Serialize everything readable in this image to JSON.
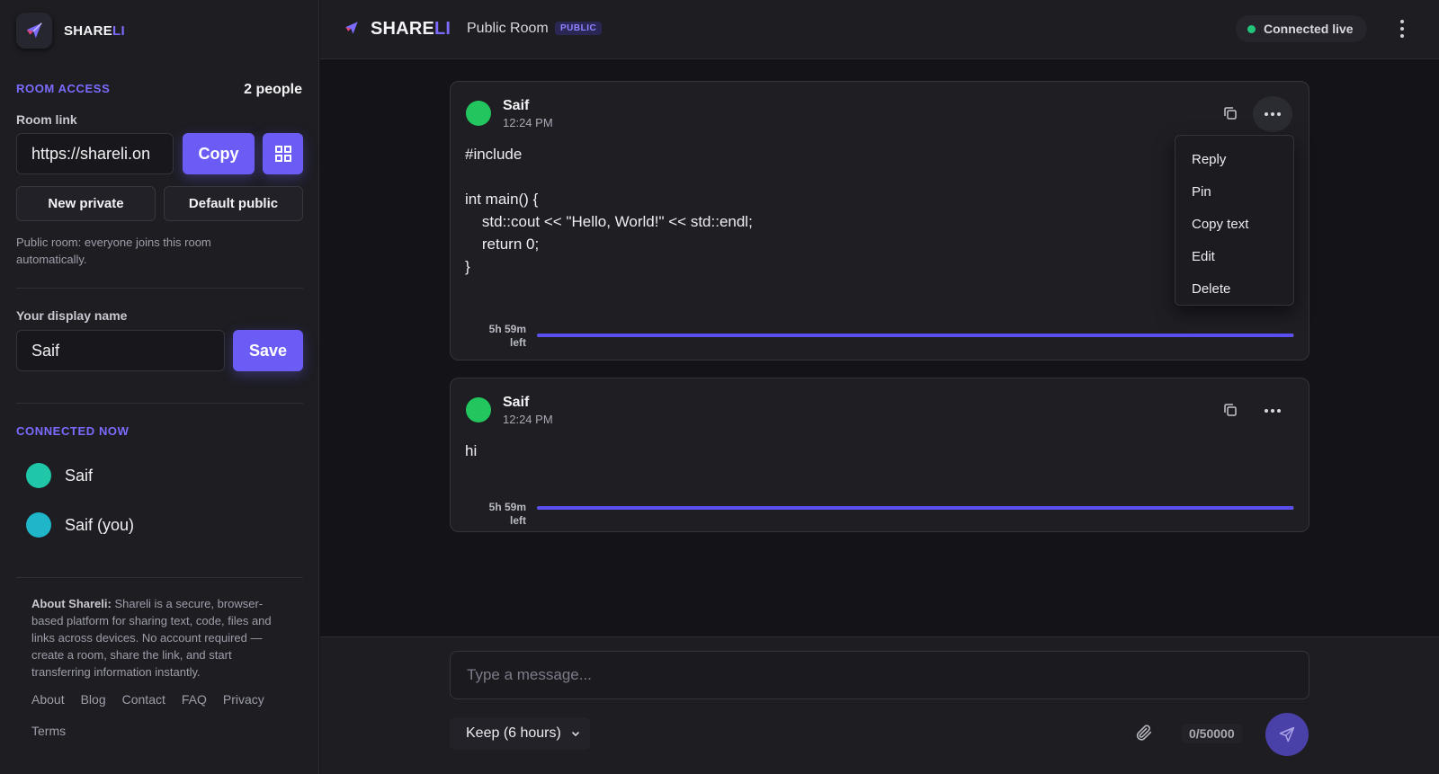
{
  "brand": {
    "name_main": "SHARE",
    "name_accent": "LI"
  },
  "sidebar": {
    "room_access_title": "ROOM ACCESS",
    "people_count": "2 people",
    "room_link_label": "Room link",
    "room_link_value": "https://shareli.on",
    "copy_label": "Copy",
    "new_private_label": "New private",
    "default_public_label": "Default public",
    "public_note": "Public room: everyone joins this room automatically.",
    "display_name_label": "Your display name",
    "display_name_value": "Saif",
    "save_label": "Save",
    "connected_title": "CONNECTED NOW",
    "users": [
      {
        "name": "Saif",
        "color": "#1fc7a8"
      },
      {
        "name": "Saif (you)",
        "color": "#1fb6c9"
      }
    ],
    "about_label": "About Shareli:",
    "about_text": " Shareli is a secure, browser-based platform for sharing text, code, files and links across devices. No account required — create a room, share the link, and start transferring information instantly.",
    "footer_links": [
      "About",
      "Blog",
      "Contact",
      "FAQ",
      "Privacy",
      "Terms"
    ]
  },
  "topbar": {
    "room_name": "Public Room",
    "badge": "PUBLIC",
    "status": "Connected live"
  },
  "messages": [
    {
      "author": "Saif",
      "time": "12:24 PM",
      "body": "#include\n\nint main() {\n    std::cout << \"Hello, World!\" << std::endl;\n    return 0;\n}",
      "expiry_line1": "5h 59m",
      "expiry_line2": "left",
      "remaining_fraction": 0.999
    },
    {
      "author": "Saif",
      "time": "12:24 PM",
      "body": "hi",
      "expiry_line1": "5h 59m",
      "expiry_line2": "left",
      "remaining_fraction": 0.999
    }
  ],
  "context_menu": [
    "Reply",
    "Pin",
    "Copy text",
    "Edit",
    "Delete"
  ],
  "composer": {
    "placeholder": "Type a message...",
    "keep_option": "Keep (6 hours)",
    "char_counter": "0/50000"
  },
  "colors": {
    "accent": "#6c5cf6",
    "status_online": "#22c47a",
    "avatar_green": "#22c55e"
  }
}
